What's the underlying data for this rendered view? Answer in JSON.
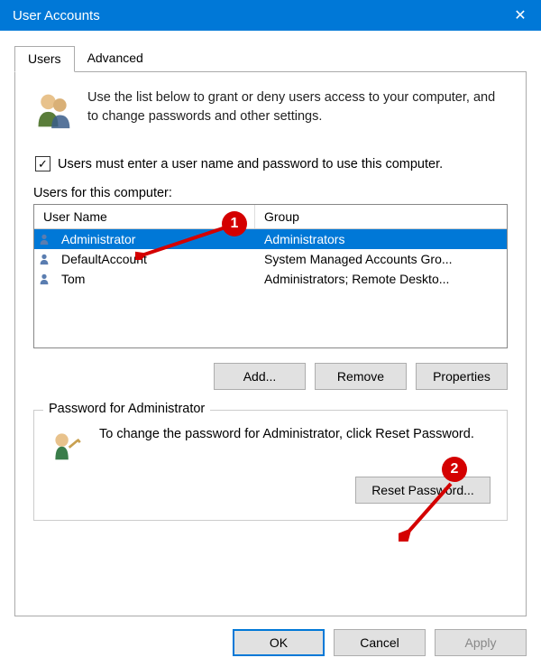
{
  "window": {
    "title": "User Accounts"
  },
  "tabs": {
    "users": "Users",
    "advanced": "Advanced"
  },
  "intro": {
    "text": "Use the list below to grant or deny users access to your computer, and to change passwords and other settings."
  },
  "checkbox": {
    "checked": true,
    "label": "Users must enter a user name and password to use this computer."
  },
  "list": {
    "label": "Users for this computer:",
    "columns": {
      "user": "User Name",
      "group": "Group"
    },
    "rows": [
      {
        "user": "Administrator",
        "group": "Administrators",
        "selected": true
      },
      {
        "user": "DefaultAccount",
        "group": "System Managed Accounts Gro...",
        "selected": false
      },
      {
        "user": "Tom",
        "group": "Administrators; Remote Deskto...",
        "selected": false
      }
    ]
  },
  "buttons": {
    "add": "Add...",
    "remove": "Remove",
    "properties": "Properties"
  },
  "password_box": {
    "title": "Password for Administrator",
    "text": "To change the password for Administrator, click Reset Password.",
    "reset_label": "Reset Password..."
  },
  "footer": {
    "ok": "OK",
    "cancel": "Cancel",
    "apply": "Apply"
  },
  "annotations": {
    "badge1": "1",
    "badge2": "2"
  }
}
